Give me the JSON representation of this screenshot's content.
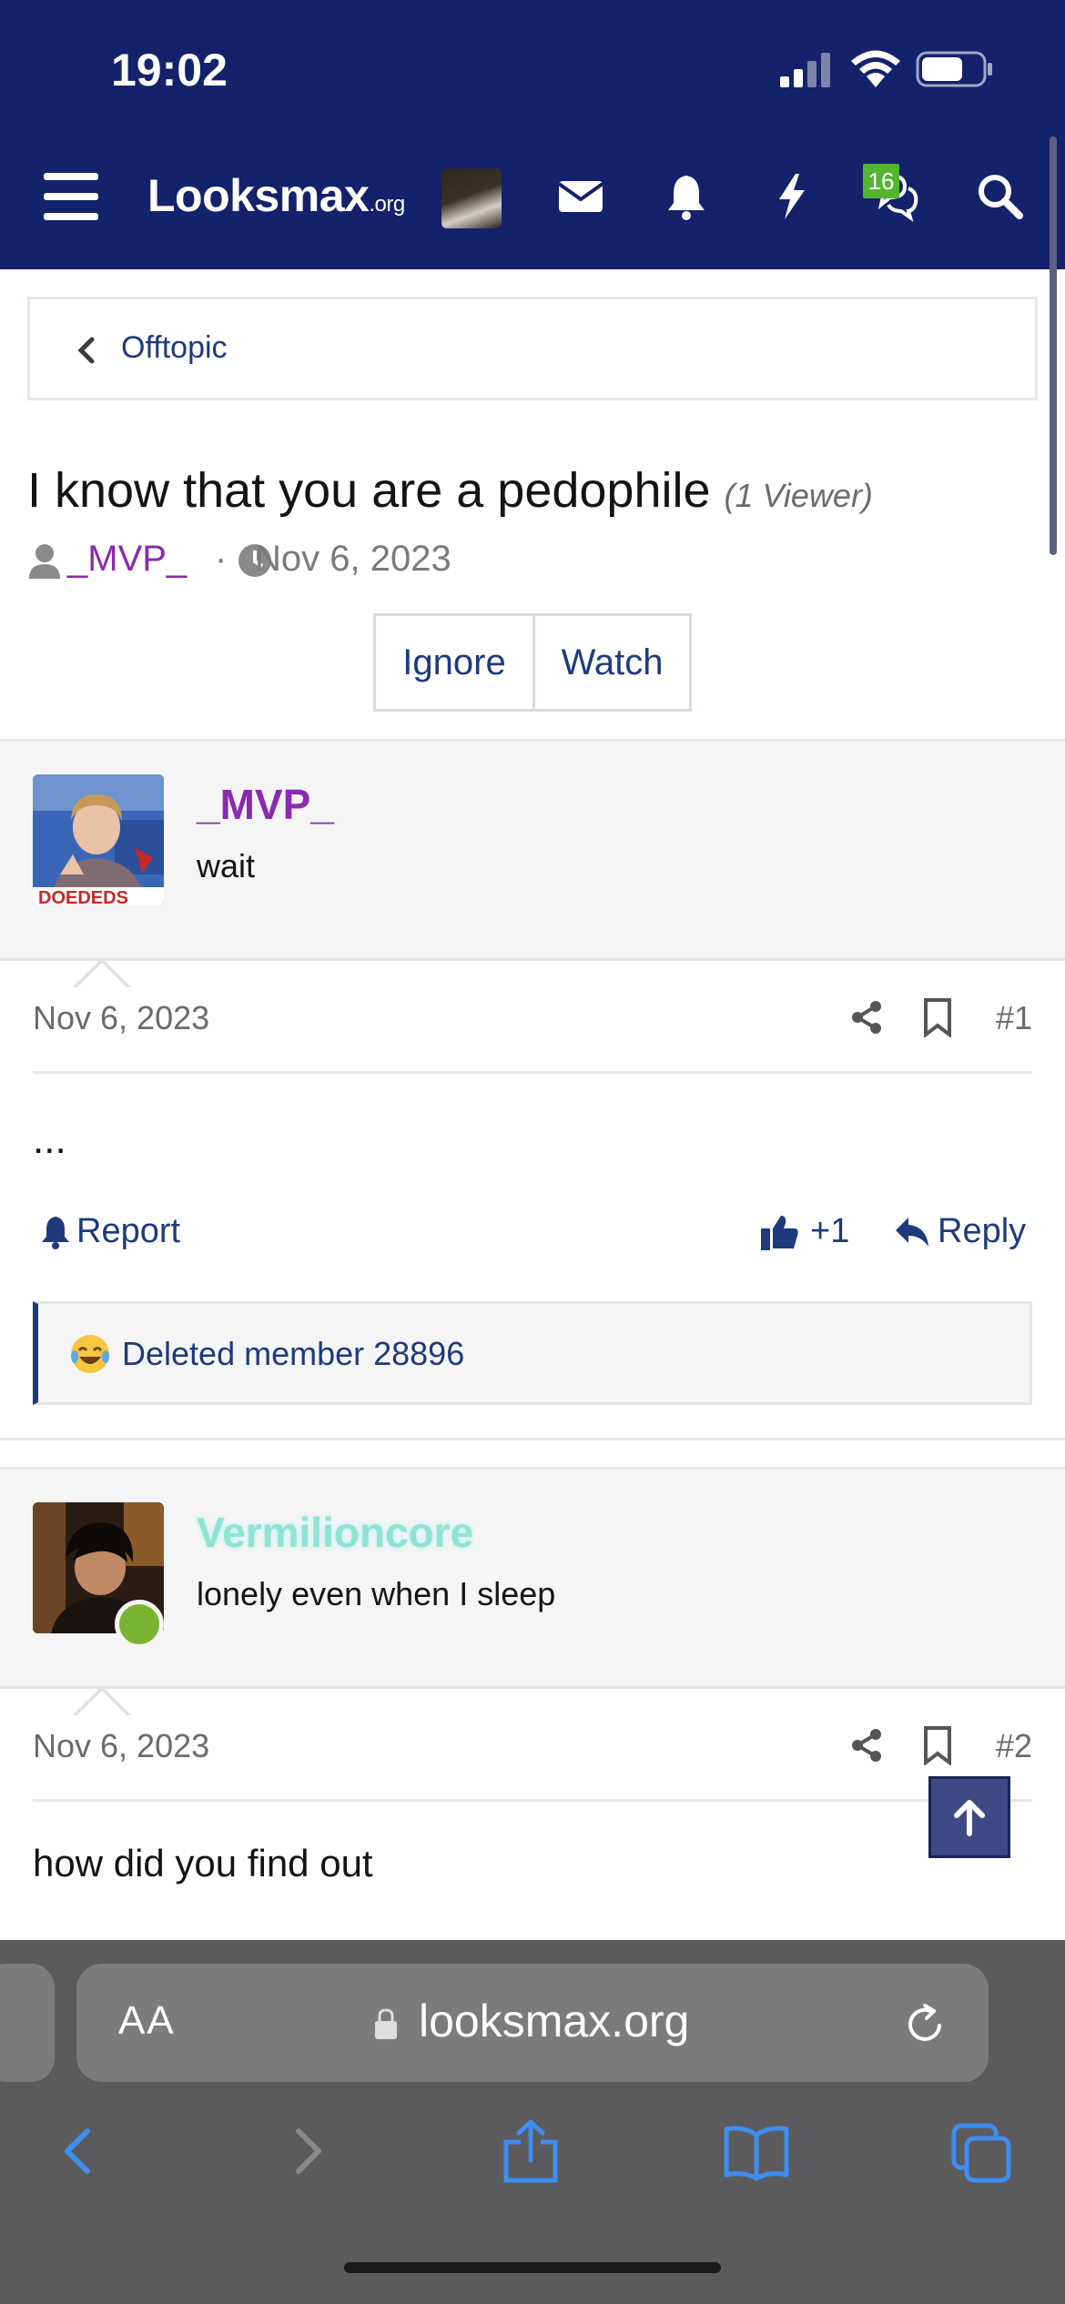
{
  "status_bar": {
    "time": "19:02"
  },
  "header": {
    "logo": "Looksmax",
    "logo_suffix": ".org",
    "notification_badge": "16"
  },
  "breadcrumb": {
    "label": "Offtopic"
  },
  "thread": {
    "title": "I know that you are a pedophile",
    "viewers": "(1 Viewer)",
    "author": "_MVP_",
    "separator": "·",
    "date": "Nov 6, 2023",
    "buttons": {
      "ignore": "Ignore",
      "watch": "Watch"
    }
  },
  "posts": [
    {
      "username": "_MVP_",
      "username_color": "#8a2ab0",
      "user_title": "wait",
      "date": "Nov 6, 2023",
      "number": "#1",
      "body": "...",
      "actions": {
        "report": "Report",
        "like_count": "+1",
        "reply": "Reply"
      },
      "reactions": "Deleted member 28896"
    },
    {
      "username": "Vermilioncore",
      "username_color": "#8fe3d4",
      "user_title": "lonely even when I sleep",
      "date": "Nov 6, 2023",
      "number": "#2",
      "body": "how did you find out"
    }
  ],
  "browser": {
    "aa_label": "AA",
    "url": "looksmax.org"
  },
  "colors": {
    "header_bg": "#14216b",
    "link": "#1d3a7c",
    "online": "#7ab531",
    "badge": "#53b52d"
  }
}
